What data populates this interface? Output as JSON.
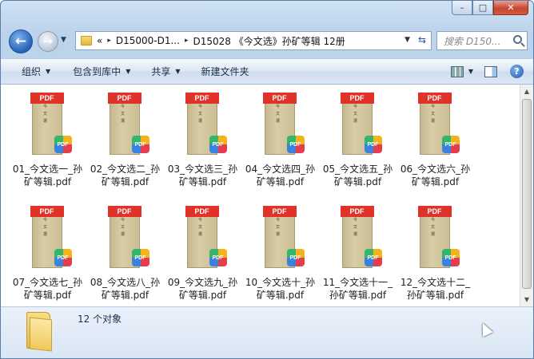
{
  "window": {
    "minimize_label": "–",
    "maximize_label": "□",
    "close_label": "✕"
  },
  "nav": {
    "back_icon": "arrow-left-icon",
    "forward_icon": "arrow-right-icon",
    "history_icon": "chevron-down-icon"
  },
  "address": {
    "overflow": "«",
    "segments": [
      "D15000-D1...",
      "D15028 《今文选》孙矿等辑 12册"
    ],
    "separator": "▸"
  },
  "search": {
    "placeholder": "搜索 D150..."
  },
  "toolbar": {
    "organize": "组织",
    "include_library": "包含到库中",
    "share": "共享",
    "new_folder": "新建文件夹"
  },
  "files": [
    {
      "name": "01_今文选一_孙矿等辑.pdf",
      "cover_title": "今文選"
    },
    {
      "name": "02_今文选二_孙矿等辑.pdf",
      "cover_title": "今文選"
    },
    {
      "name": "03_今文选三_孙矿等辑.pdf",
      "cover_title": "今文選"
    },
    {
      "name": "04_今文选四_孙矿等辑.pdf",
      "cover_title": "今文選"
    },
    {
      "name": "05_今文选五_孙矿等辑.pdf",
      "cover_title": "今文選"
    },
    {
      "name": "06_今文选六_孙矿等辑.pdf",
      "cover_title": "今文選"
    },
    {
      "name": "07_今文选七_孙矿等辑.pdf",
      "cover_title": "今文選"
    },
    {
      "name": "08_今文选八_孙矿等辑.pdf",
      "cover_title": "今文選"
    },
    {
      "name": "09_今文选九_孙矿等辑.pdf",
      "cover_title": "今文選"
    },
    {
      "name": "10_今文选十_孙矿等辑.pdf",
      "cover_title": "今文選"
    },
    {
      "name": "11_今文选十一_孙矿等辑.pdf",
      "cover_title": "今文選"
    },
    {
      "name": "12_今文选十二_孙矿等辑.pdf",
      "cover_title": "今文選"
    }
  ],
  "pdf_band": "PDF",
  "pdf_badge": "PDF",
  "status": {
    "count_text": "12 个对象"
  },
  "colors": {
    "pdf_red": "#e1322a",
    "window_blue": "#bcd3ec"
  }
}
